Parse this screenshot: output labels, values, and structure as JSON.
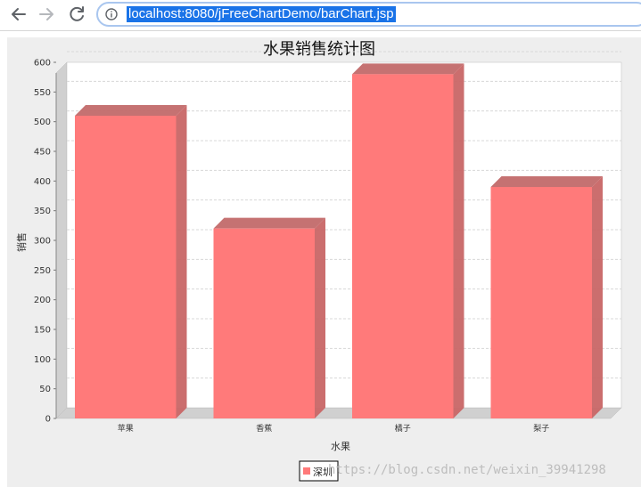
{
  "browser": {
    "url": "localhost:8080/jFreeChartDemo/barChart.jsp",
    "back_icon": "arrow-left-icon",
    "forward_icon": "arrow-right-icon",
    "reload_icon": "reload-icon",
    "info_icon": "info-icon"
  },
  "watermark": "https://blog.csdn.net/weixin_39941298",
  "chart_data": {
    "type": "bar",
    "title": "水果销售统计图",
    "xlabel": "水果",
    "ylabel": "销售",
    "categories": [
      "苹果",
      "香蕉",
      "橘子",
      "梨子"
    ],
    "series": [
      {
        "name": "深圳",
        "values": [
          510,
          320,
          580,
          390
        ]
      }
    ],
    "ylim": [
      0,
      600
    ],
    "yticks": [
      0,
      50,
      100,
      150,
      200,
      250,
      300,
      350,
      400,
      450,
      500,
      550,
      600
    ],
    "grid": true,
    "legend": "bottom",
    "style": "3d",
    "colors": {
      "bar": "#ff7a7a",
      "bar_side": "#c86666",
      "bar_top": "#c26a6a",
      "plot_background": "#ffffff",
      "panel_background": "#eeeeee",
      "gridline": "#d8d8d8",
      "wall": "#d0d0d0"
    }
  }
}
